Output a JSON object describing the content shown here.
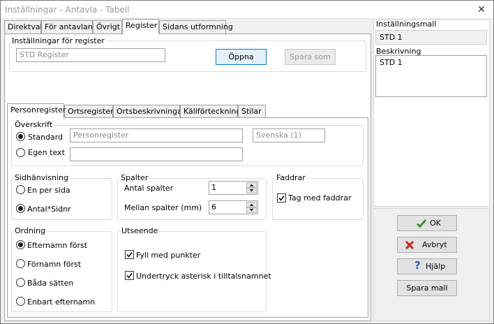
{
  "window": {
    "title": "Inställningar - Antavla - Tabell",
    "close_glyph": "✕"
  },
  "main_tabs": [
    "Direktval",
    "För antavlan",
    "Övrigt",
    "Register",
    "Sidans utformning"
  ],
  "register_group": {
    "label": "Inställningar för register",
    "template_value": "STD Register",
    "open_button": "Öppna",
    "save_as_button": "Spara som"
  },
  "sub_tabs": [
    "Personregister",
    "Ortsregister",
    "Ortsbeskrivningar",
    "Källförteckning",
    "Stilar"
  ],
  "heading_group": {
    "label": "Överskrift",
    "standard_label": "Standard",
    "standard_value": "Personregister",
    "language_value": "Svenska (1)",
    "custom_label": "Egen text",
    "custom_value": ""
  },
  "page_ref_group": {
    "label": "Sidhänvisning",
    "options": [
      "En per sida",
      "Antal*Sidnr"
    ],
    "selected": "Antal*Sidnr"
  },
  "columns_group": {
    "label": "Spalter",
    "count_label": "Antal spalter",
    "count_value": "1",
    "between_label": "Mellan spalter (mm)",
    "between_value": "6"
  },
  "godparents_group": {
    "label": "Faddrar",
    "include_label": "Tag med faddrar",
    "include_checked": true
  },
  "order_group": {
    "label": "Ordning",
    "options": [
      "Efternamn först",
      "Förnamn först",
      "Båda sätten",
      "Enbart efternamn"
    ],
    "selected": "Efternamn först"
  },
  "appearance_group": {
    "label": "Utseende",
    "fill_label": "Fyll med punkter",
    "fill_checked": true,
    "suppress_label": "Undertryck asterisk i tilltalsnamnet",
    "suppress_checked": true
  },
  "right_panel": {
    "template_label": "Inställningsmall",
    "template_value": "STD 1",
    "description_label": "Beskrivning",
    "description_value": "STD 1"
  },
  "buttons": {
    "ok": "OK",
    "cancel": "Avbryt",
    "help": "Hjälp",
    "save_template": "Spara mall"
  },
  "colors": {
    "ok_check": "#2e8b1f",
    "cancel_x": "#c0281c",
    "help_q": "#1d5fc2"
  }
}
